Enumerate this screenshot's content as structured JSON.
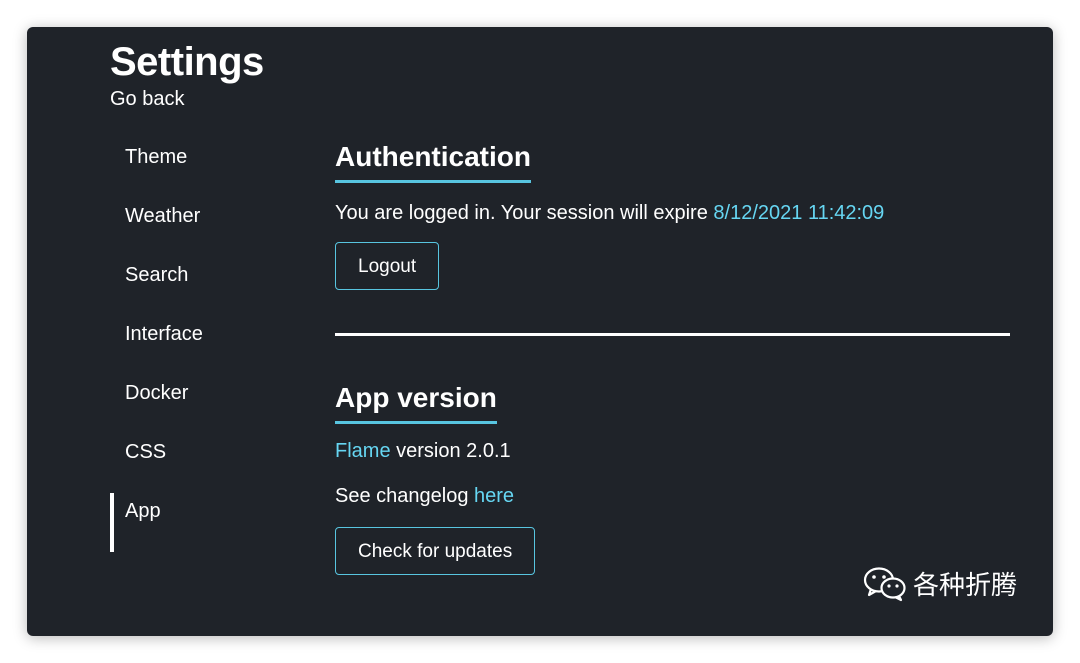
{
  "header": {
    "title": "Settings",
    "back_label": "Go back"
  },
  "sidebar": {
    "items": [
      {
        "label": "Theme"
      },
      {
        "label": "Weather"
      },
      {
        "label": "Search"
      },
      {
        "label": "Interface"
      },
      {
        "label": "Docker"
      },
      {
        "label": "CSS"
      },
      {
        "label": "App",
        "active": true
      }
    ]
  },
  "auth": {
    "title": "Authentication",
    "status_text": "You are logged in. Your session will expire ",
    "expiry": "8/12/2021 11:42:09",
    "logout_label": "Logout"
  },
  "app_version": {
    "title": "App version",
    "app_name": "Flame",
    "version_text": " version 2.0.1",
    "changelog_text": "See changelog ",
    "changelog_link": "here",
    "check_updates_label": "Check for updates"
  },
  "watermark": {
    "icon": "wechat-icon",
    "text": "各种折腾"
  },
  "colors": {
    "background": "#1f2329",
    "accent": "#66d6f2",
    "accent_border": "#58c5e0",
    "text": "#ffffff"
  }
}
